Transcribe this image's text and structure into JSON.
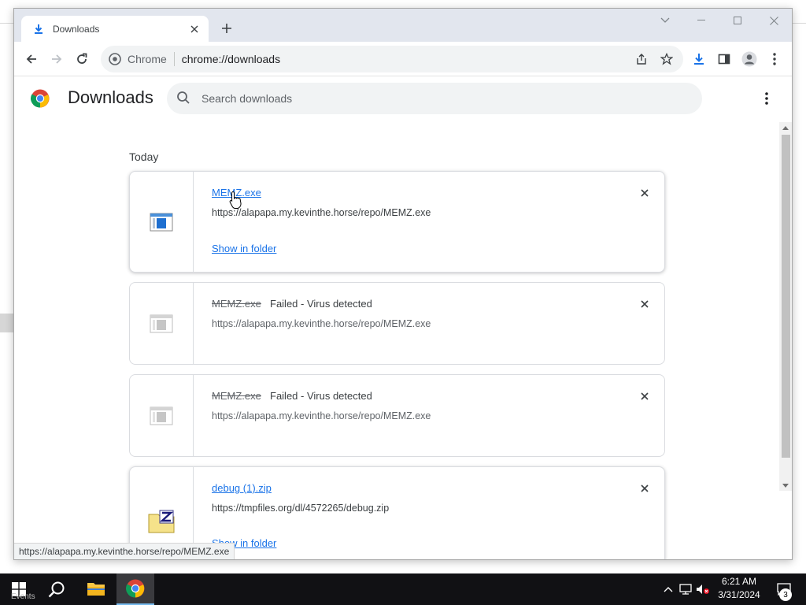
{
  "window": {
    "tab_title": "Downloads",
    "tab_close": "×",
    "new_tab": "+"
  },
  "toolbar": {
    "omnibox_chip": "Chrome",
    "omnibox_url": "chrome://downloads"
  },
  "page": {
    "title": "Downloads",
    "search_placeholder": "Search downloads",
    "section_label": "Today"
  },
  "downloads": [
    {
      "file_name": "MEMZ.exe",
      "status": "",
      "url": "https://alapapa.my.kevinthe.horse/repo/MEMZ.exe",
      "action": "Show in folder",
      "failed": false,
      "icon": "exe-file-icon"
    },
    {
      "file_name": "MEMZ.exe",
      "status": "Failed - Virus detected",
      "url": "https://alapapa.my.kevinthe.horse/repo/MEMZ.exe",
      "action": "",
      "failed": true,
      "icon": "exe-file-icon-gray"
    },
    {
      "file_name": "MEMZ.exe",
      "status": "Failed - Virus detected",
      "url": "https://alapapa.my.kevinthe.horse/repo/MEMZ.exe",
      "action": "",
      "failed": true,
      "icon": "exe-file-icon-gray"
    },
    {
      "file_name": "debug (1).zip",
      "status": "",
      "url": "https://tmpfiles.org/dl/4572265/debug.zip",
      "action": "Show in folder",
      "failed": false,
      "icon": "zip-file-icon"
    }
  ],
  "status_bubble": "https://alapapa.my.kevinthe.horse/repo/MEMZ.exe",
  "taskbar": {
    "time": "6:21 AM",
    "date": "3/31/2024",
    "notification_count": "3",
    "weather_text": "Events"
  },
  "colors": {
    "link": "#1a73e8",
    "taskbar": "#111114",
    "tab_strip": "#e2e6ee"
  }
}
